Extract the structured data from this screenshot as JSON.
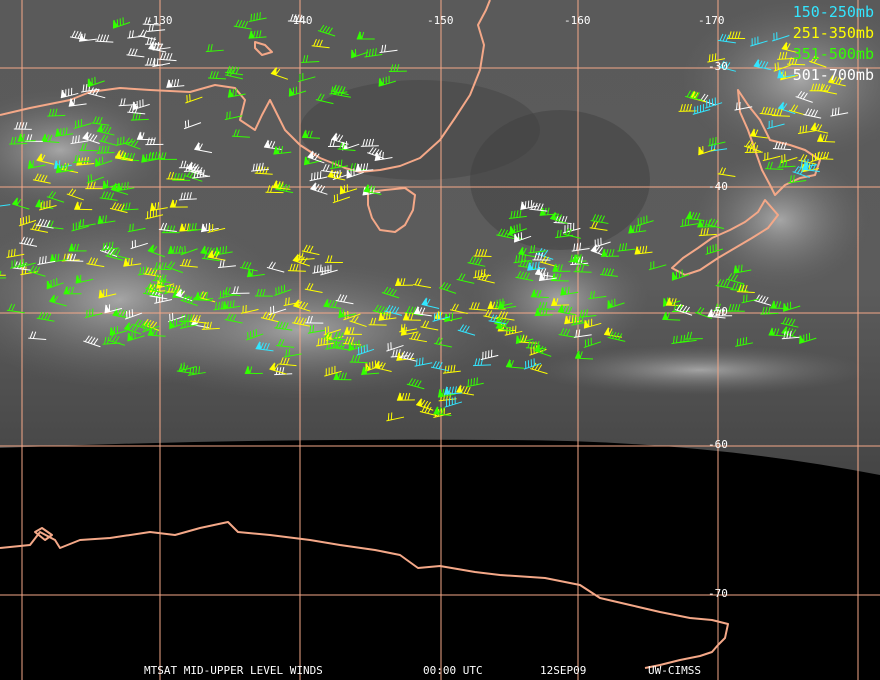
{
  "legend": {
    "items": [
      {
        "label": "150-250mb",
        "color": "#33e6ff"
      },
      {
        "label": "251-350mb",
        "color": "#ffff00"
      },
      {
        "label": "351-500mb",
        "color": "#33ff00"
      },
      {
        "label": "501-700mb",
        "color": "#ffffff"
      }
    ]
  },
  "grid": {
    "longitudes": [
      "-130",
      "-140",
      "-150",
      "-160",
      "-170"
    ],
    "latitudes": [
      "-30",
      "-40",
      "-50",
      "-60",
      "-70"
    ],
    "line_color": "#f4a888"
  },
  "coastline_color": "#f4a888",
  "footer": {
    "product": "MTSAT MID-UPPER LEVEL WINDS",
    "time": "00:00 UTC",
    "date": "12SEP09",
    "credit": "UW-CIMSS"
  }
}
